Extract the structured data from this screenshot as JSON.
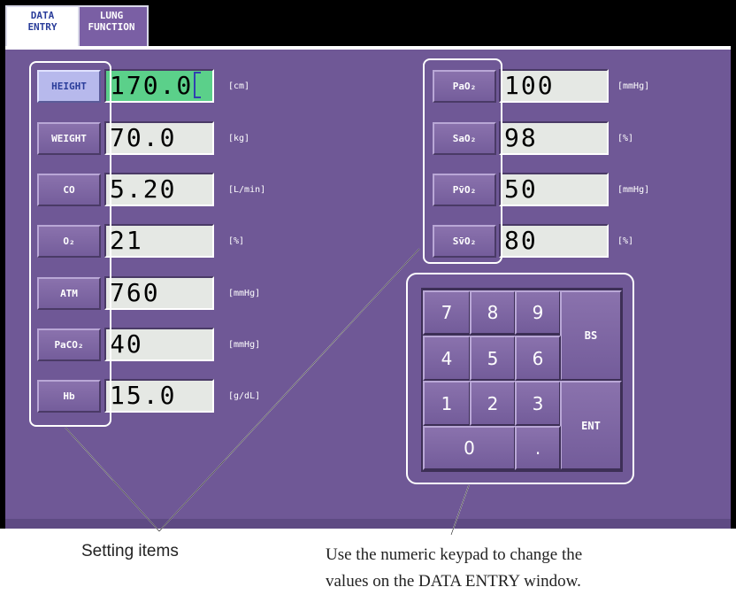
{
  "tabs": [
    {
      "label": "DATA\nENTRY",
      "active": true
    },
    {
      "label": "LUNG\nFUNCTION",
      "active": false
    }
  ],
  "left_items": [
    {
      "label": "HEIGHT",
      "value": "170.0",
      "unit": "[cm]",
      "active": true
    },
    {
      "label": "WEIGHT",
      "value": "70.0",
      "unit": "[kg]"
    },
    {
      "label": "CO",
      "value": "5.20",
      "unit": "[L/min]"
    },
    {
      "label": "O₂",
      "value": "21",
      "unit": "[%]"
    },
    {
      "label": "ATM",
      "value": "760",
      "unit": "[mmHg]"
    },
    {
      "label": "PaCO₂",
      "value": "40",
      "unit": "[mmHg]"
    },
    {
      "label": "Hb",
      "value": "15.0",
      "unit": "[g/dL]"
    }
  ],
  "right_items": [
    {
      "label": "PaO₂",
      "value": "100",
      "unit": "[mmHg]"
    },
    {
      "label": "SaO₂",
      "value": "98",
      "unit": "[%]"
    },
    {
      "label": "Pv̄O₂",
      "value": "50",
      "unit": "[mmHg]"
    },
    {
      "label": "Sv̄O₂",
      "value": "80",
      "unit": "[%]"
    }
  ],
  "keypad": {
    "digits": [
      "7",
      "8",
      "9",
      "4",
      "5",
      "6",
      "1",
      "2",
      "3"
    ],
    "zero": "0",
    "dot": ".",
    "backspace": "BS",
    "enter": "ENT"
  },
  "captions": {
    "setting_items": "Setting items",
    "keypad_line1": "Use the numeric keypad to change the",
    "keypad_line2": "values on the DATA ENTRY window."
  },
  "colors": {
    "panel": "#6f5896",
    "active_field": "#5bd08a",
    "active_label": "#b7b9ec"
  }
}
